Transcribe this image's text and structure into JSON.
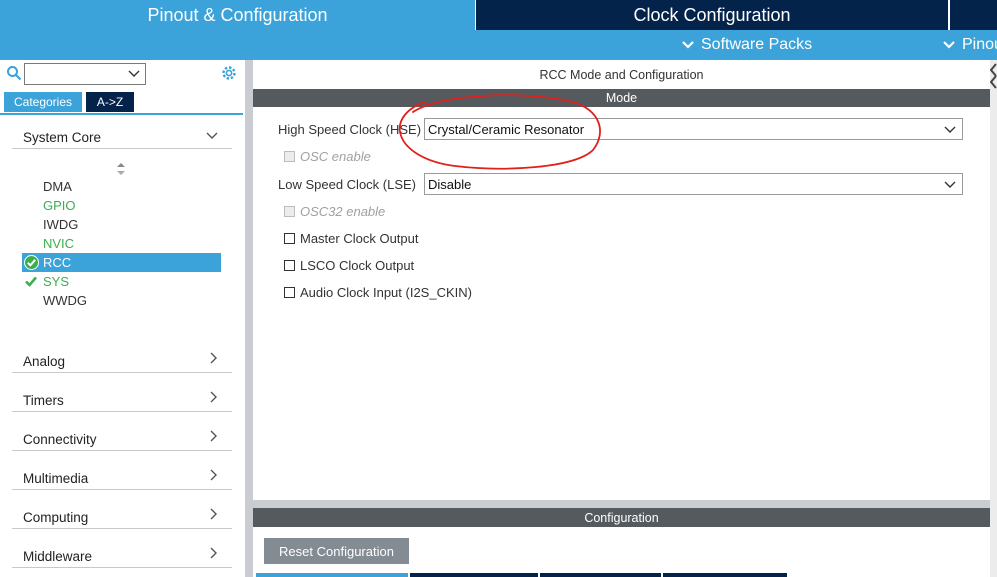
{
  "top_tabs": {
    "pinout": "Pinout & Configuration",
    "clock": "Clock Configuration"
  },
  "subbar": {
    "software_packs": "Software Packs",
    "pinout": "Pinou"
  },
  "left": {
    "search_value": "",
    "tabs": {
      "categories": "Categories",
      "az": "A->Z"
    },
    "system_core": {
      "label": "System Core",
      "items": [
        {
          "label": "DMA",
          "state": "none"
        },
        {
          "label": "GPIO",
          "state": "green"
        },
        {
          "label": "IWDG",
          "state": "none"
        },
        {
          "label": "NVIC",
          "state": "green"
        },
        {
          "label": "RCC",
          "state": "selected"
        },
        {
          "label": "SYS",
          "state": "checked"
        },
        {
          "label": "WWDG",
          "state": "none"
        }
      ]
    },
    "groups": [
      "Analog",
      "Timers",
      "Connectivity",
      "Multimedia",
      "Computing",
      "Middleware"
    ]
  },
  "main": {
    "title": "RCC Mode and Configuration",
    "mode_header": "Mode",
    "hse": {
      "label": "High Speed Clock (HSE)",
      "value": "Crystal/Ceramic Resonator"
    },
    "osc_enable": "OSC enable",
    "lse": {
      "label": "Low Speed Clock (LSE)",
      "value": "Disable"
    },
    "osc32_enable": "OSC32 enable",
    "checkboxes": [
      "Master Clock Output",
      "LSCO Clock Output",
      "Audio Clock Input (I2S_CKIN)"
    ],
    "config_header": "Configuration",
    "reset_button": "Reset Configuration"
  },
  "colors": {
    "accent_blue": "#3ba3d9",
    "dark_navy": "#03234b",
    "header_gray": "#555a5e",
    "status_green": "#3cae4e",
    "annotation_red": "#e0201b"
  }
}
